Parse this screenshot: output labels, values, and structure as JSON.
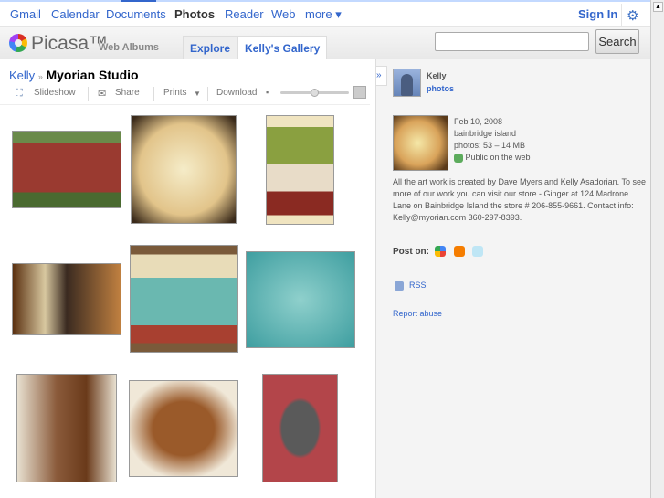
{
  "topnav": {
    "links": [
      "Gmail",
      "Calendar",
      "Documents",
      "Photos",
      "Reader",
      "Web",
      "more ▾"
    ],
    "active": "Photos",
    "sign_in": "Sign In",
    "settings_icon": "gear-icon"
  },
  "header": {
    "logo": "Picasa™",
    "logo_sub": "Web Albums",
    "tabs": [
      "Explore",
      "Kelly's Gallery"
    ],
    "selected_tab": "Kelly's Gallery",
    "search_value": "",
    "search_button": "Search"
  },
  "breadcrumb": {
    "owner": "Kelly",
    "sep": "»",
    "album": "Myorian Studio"
  },
  "toolbar": {
    "slideshow": "Slideshow",
    "share": "Share",
    "prints": "Prints",
    "download": "Download",
    "size_slider_level": 0.5
  },
  "photos": [
    {
      "desc": "red house",
      "color": "#8e4036"
    },
    {
      "desc": "amber branch panel",
      "color": "#e6c990"
    },
    {
      "desc": "green and red panel",
      "color": "#c9b27d"
    },
    {
      "desc": "lit wall panel",
      "color": "#7a4a20"
    },
    {
      "desc": "teal circles panel",
      "color": "#6fb0a8"
    },
    {
      "desc": "teal dark stems",
      "color": "#4aa7a8"
    },
    {
      "desc": "swirl sculpture room",
      "color": "#8a5a3a"
    },
    {
      "desc": "swirl sculpture",
      "color": "#9a5a2a"
    },
    {
      "desc": "tree on red wall",
      "color": "#b3454a"
    }
  ],
  "sidebar": {
    "owner": "Kelly",
    "photos_link": "photos",
    "date": "Feb 10, 2008",
    "location": "bainbridge island",
    "count": "photos: 53 – 14 MB",
    "visibility": "Public on the web",
    "description": "All the art work is created by Dave Myers and Kelly Asadorian. To see more of our work you can visit our store - Ginger at 124 Madrone Lane on Bainbridge Island the store # 206-855-9661. Contact info: Kelly@myorian.com 360-297-8393.",
    "post_on": "Post on:",
    "rss": "RSS",
    "report": "Report abuse"
  }
}
